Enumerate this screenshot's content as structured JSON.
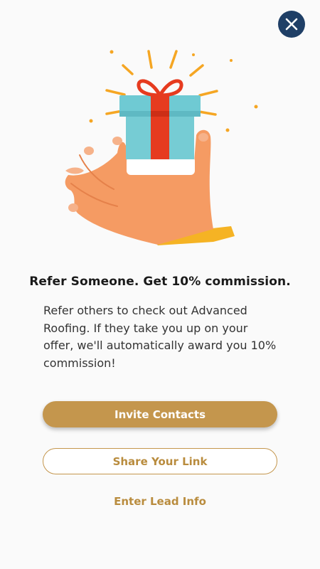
{
  "header": {
    "close_icon": "close-icon"
  },
  "illustration": {
    "icon": "gift-hand-illustration"
  },
  "content": {
    "headline": "Refer Someone. Get 10% commission.",
    "body": "Refer others to check out Advanced Roofing. If they take you up on your offer, we'll automatically award you 10% commission!"
  },
  "actions": {
    "invite_label": "Invite Contacts",
    "share_label": "Share Your Link",
    "lead_label": "Enter Lead Info"
  },
  "colors": {
    "accent": "#c4964d",
    "close_bg": "#1f3f66",
    "gift_box": "#6fcad3",
    "ribbon": "#e63b1f",
    "hand": "#f59b63",
    "sleeve": "#f5b324"
  }
}
